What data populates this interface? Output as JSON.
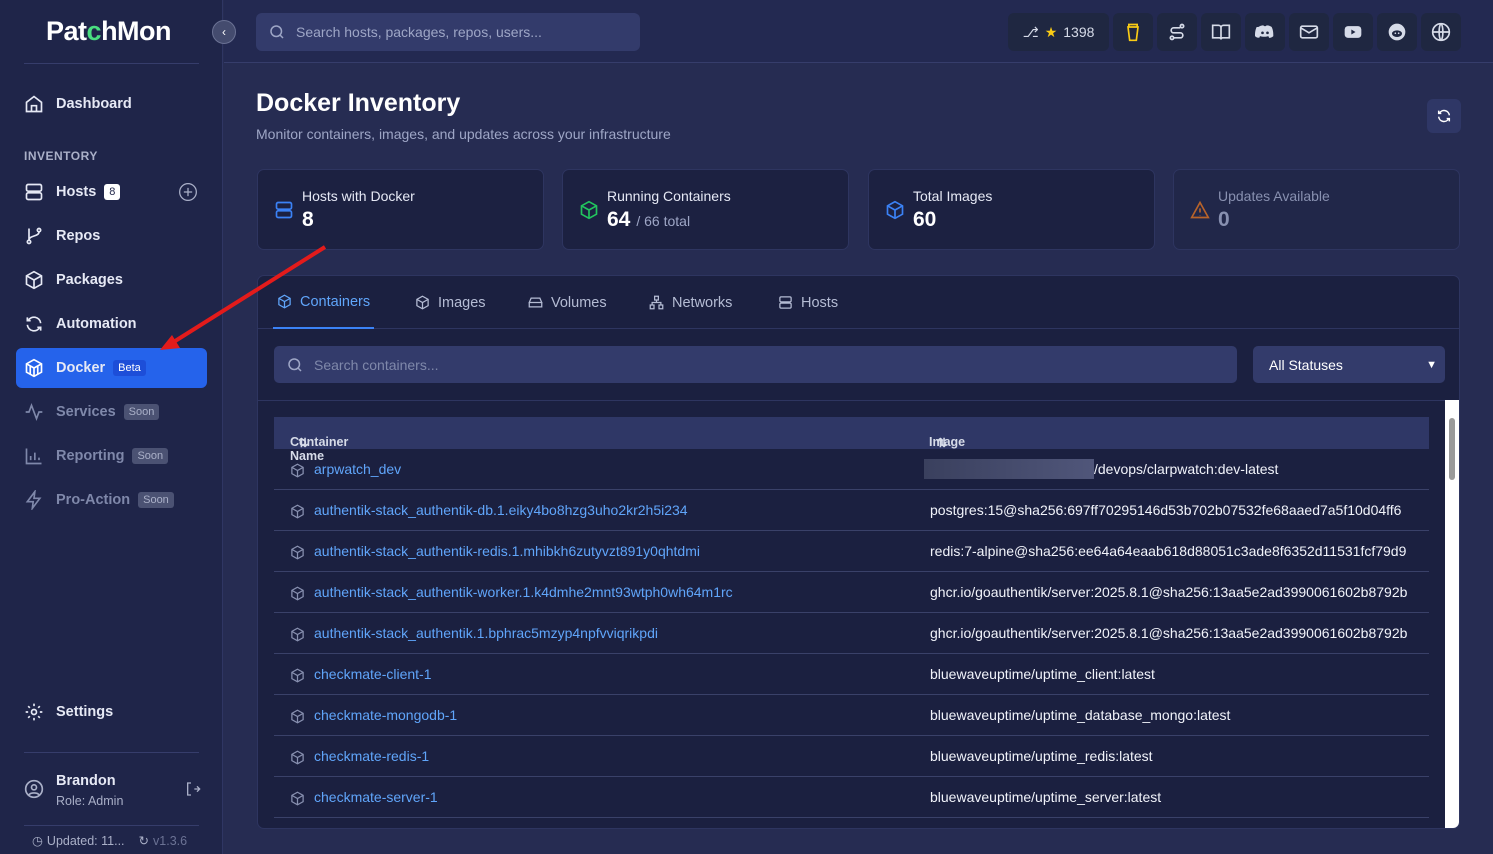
{
  "app": {
    "logo": "PatchMon"
  },
  "topbar": {
    "search_placeholder": "Search hosts, packages, repos, users...",
    "github_stars": "1398"
  },
  "sidebar": {
    "dashboard": "Dashboard",
    "section": "INVENTORY",
    "items": [
      {
        "label": "Hosts",
        "badge": "8"
      },
      {
        "label": "Repos"
      },
      {
        "label": "Packages"
      },
      {
        "label": "Automation"
      },
      {
        "label": "Docker",
        "badge": "Beta"
      },
      {
        "label": "Services",
        "badge": "Soon"
      },
      {
        "label": "Reporting",
        "badge": "Soon"
      },
      {
        "label": "Pro-Action",
        "badge": "Soon"
      }
    ],
    "settings": "Settings",
    "user": {
      "name": "Brandon",
      "role": "Role: Admin"
    },
    "footer": {
      "updated": "Updated: 11...",
      "version": "v1.3.6"
    }
  },
  "page": {
    "title": "Docker Inventory",
    "subtitle": "Monitor containers, images, and updates across your infrastructure"
  },
  "stats": [
    {
      "label": "Hosts with Docker",
      "value": "8",
      "extra": ""
    },
    {
      "label": "Running Containers",
      "value": "64",
      "extra": "/ 66 total"
    },
    {
      "label": "Total Images",
      "value": "60",
      "extra": ""
    },
    {
      "label": "Updates Available",
      "value": "0",
      "extra": ""
    }
  ],
  "tabs": [
    "Containers",
    "Images",
    "Volumes",
    "Networks",
    "Hosts"
  ],
  "filters": {
    "search_placeholder": "Search containers...",
    "status": "All Statuses"
  },
  "table": {
    "columns": [
      "Container Name",
      "Image"
    ],
    "rows": [
      {
        "name": "arpwatch_dev",
        "image": "/devops/clarpwatch:dev-latest",
        "redacted": true
      },
      {
        "name": "authentik-stack_authentik-db.1.eiky4bo8hzg3uho2kr2h5i234",
        "image": "postgres:15@sha256:697ff70295146d53b702b07532fe68aaed7a5f10d04ff6"
      },
      {
        "name": "authentik-stack_authentik-redis.1.mhibkh6zutyvzt891y0qhtdmi",
        "image": "redis:7-alpine@sha256:ee64a64eaab618d88051c3ade8f6352d11531fcf79d9"
      },
      {
        "name": "authentik-stack_authentik-worker.1.k4dmhe2mnt93wtph0wh64m1rc",
        "image": "ghcr.io/goauthentik/server:2025.8.1@sha256:13aa5e2ad3990061602b8792b"
      },
      {
        "name": "authentik-stack_authentik.1.bphrac5mzyp4npfvviqrikpdi",
        "image": "ghcr.io/goauthentik/server:2025.8.1@sha256:13aa5e2ad3990061602b8792b"
      },
      {
        "name": "checkmate-client-1",
        "image": "bluewaveuptime/uptime_client:latest"
      },
      {
        "name": "checkmate-mongodb-1",
        "image": "bluewaveuptime/uptime_database_mongo:latest"
      },
      {
        "name": "checkmate-redis-1",
        "image": "bluewaveuptime/uptime_redis:latest"
      },
      {
        "name": "checkmate-server-1",
        "image": "bluewaveuptime/uptime_server:latest"
      }
    ]
  }
}
